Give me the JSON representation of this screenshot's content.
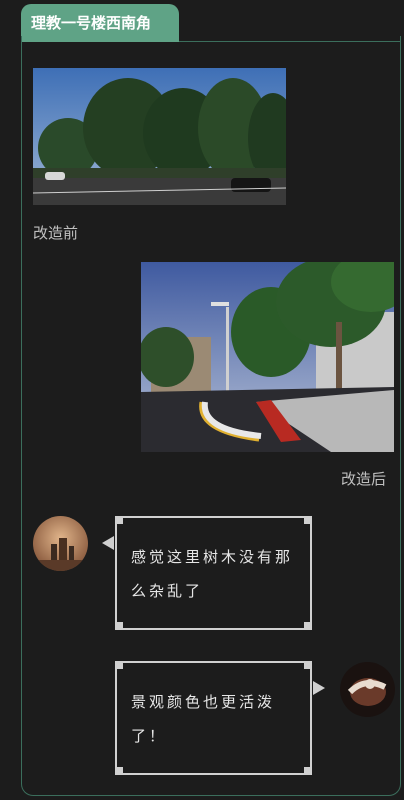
{
  "header": {
    "title": "理教一号楼西南角",
    "accent": "#5fa386"
  },
  "photos": {
    "before_caption": "改造前",
    "after_caption": "改造后"
  },
  "messages": [
    {
      "side": "left",
      "text": "感觉这里树木没有那么杂乱了"
    },
    {
      "side": "right",
      "text": "景观颜色也更活泼了！"
    }
  ]
}
